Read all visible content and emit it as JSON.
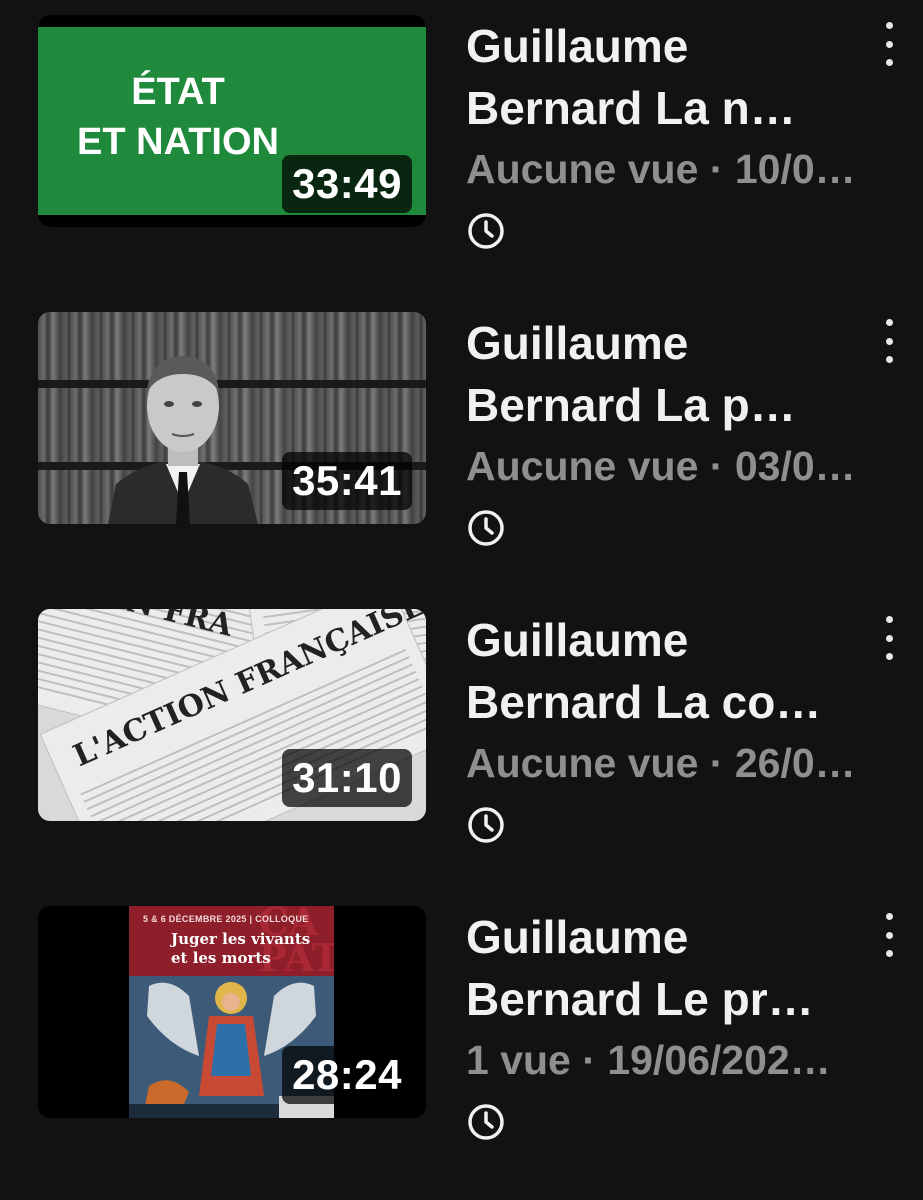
{
  "videos": [
    {
      "title_line1": "Guillaume",
      "title_line2": "Bernard La n…",
      "views": "Aucune vue",
      "date": "10/0…",
      "duration": "33:49",
      "thumb_text_line1": "ÉTAT",
      "thumb_text_line2": "ET NATION",
      "thumb_color": "#1f8a3b"
    },
    {
      "title_line1": "Guillaume",
      "title_line2": "Bernard La p…",
      "views": "Aucune vue",
      "date": "03/0…",
      "duration": "35:41"
    },
    {
      "title_line1": "Guillaume",
      "title_line2": "Bernard La co…",
      "views": "Aucune vue",
      "date": "26/0…",
      "duration": "31:10",
      "thumb_text_main": "L'ACTION FRANÇAISE",
      "thumb_text_top": "ON FRA"
    },
    {
      "title_line1": "Guillaume",
      "title_line2": "Bernard Le pr…",
      "views": "1 vue",
      "date": "19/06/202…",
      "duration": "28:24",
      "poster_small": "5 & 6 DÉCEMBRE 2025 | COLLOQUE",
      "poster_title_line1": "Juger les vivants",
      "poster_title_line2": "et les morts"
    }
  ],
  "separator": "·",
  "icons": {
    "more": "more-vert-icon",
    "clock": "watch-later-icon"
  }
}
